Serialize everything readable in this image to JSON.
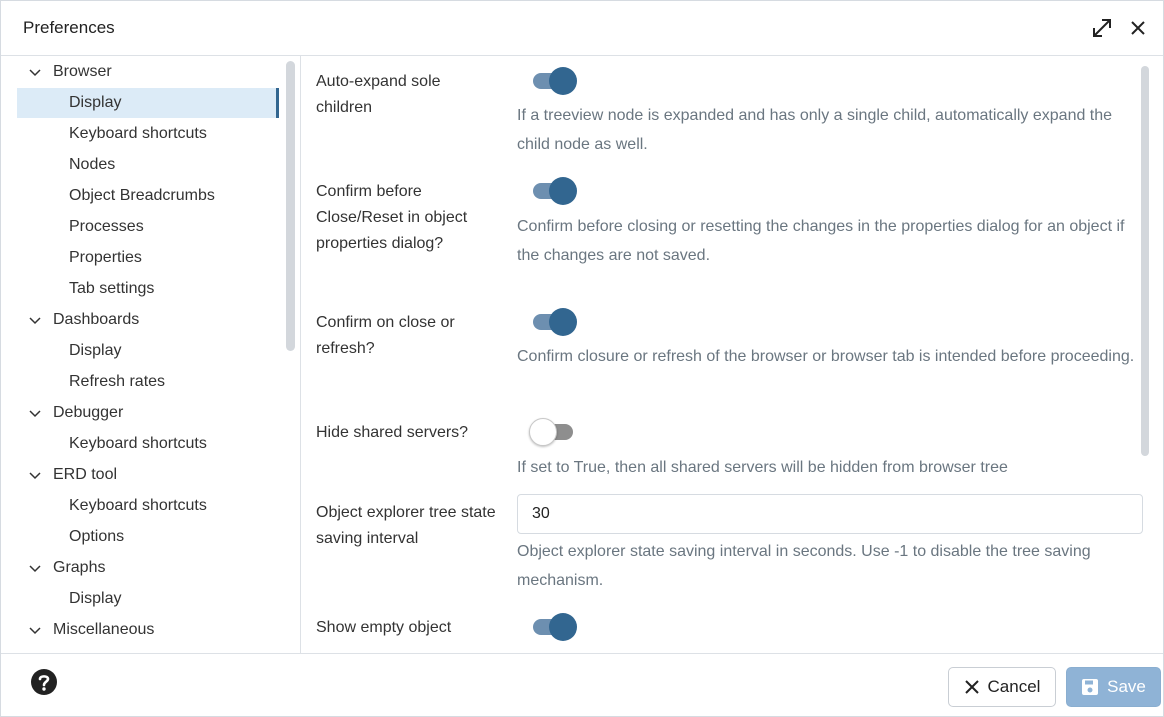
{
  "dialog": {
    "title": "Preferences",
    "icons": {
      "expand": "expand-icon",
      "close": "close-icon"
    }
  },
  "sidebar": {
    "groups": [
      {
        "label": "Browser",
        "children": [
          "Display",
          "Keyboard shortcuts",
          "Nodes",
          "Object Breadcrumbs",
          "Processes",
          "Properties",
          "Tab settings"
        ]
      },
      {
        "label": "Dashboards",
        "children": [
          "Display",
          "Refresh rates"
        ]
      },
      {
        "label": "Debugger",
        "children": [
          "Keyboard shortcuts"
        ]
      },
      {
        "label": "ERD tool",
        "children": [
          "Keyboard shortcuts",
          "Options"
        ]
      },
      {
        "label": "Graphs",
        "children": [
          "Display"
        ]
      },
      {
        "label": "Miscellaneous",
        "children": []
      }
    ],
    "selected": "Browser > Display"
  },
  "prefs": [
    {
      "label": "Auto-expand sole children",
      "type": "toggle",
      "value": true,
      "help": "If a treeview node is expanded and has only a single child, automatically expand the child node as well."
    },
    {
      "label": "Confirm before Close/Reset in object properties dialog?",
      "type": "toggle",
      "value": true,
      "help": "Confirm before closing or resetting the changes in the properties dialog for an object if the changes are not saved."
    },
    {
      "label": "Confirm on close or refresh?",
      "type": "toggle",
      "value": true,
      "help": "Confirm closure or refresh of the browser or browser tab is intended before proceeding."
    },
    {
      "label": "Hide shared servers?",
      "type": "toggle",
      "value": false,
      "help": "If set to True, then all shared servers will be hidden from browser tree"
    },
    {
      "label": "Object explorer tree state saving interval",
      "type": "number",
      "value": "30",
      "help": "Object explorer state saving interval in seconds. Use -1 to disable the tree saving mechanism."
    },
    {
      "label": "Show empty object",
      "type": "toggle",
      "value": true,
      "help": ""
    }
  ],
  "footer": {
    "cancel_label": "Cancel",
    "save_label": "Save"
  },
  "colors": {
    "accent": "#326690",
    "selected_bg": "#dcebf7",
    "help_text": "#6a7680"
  }
}
